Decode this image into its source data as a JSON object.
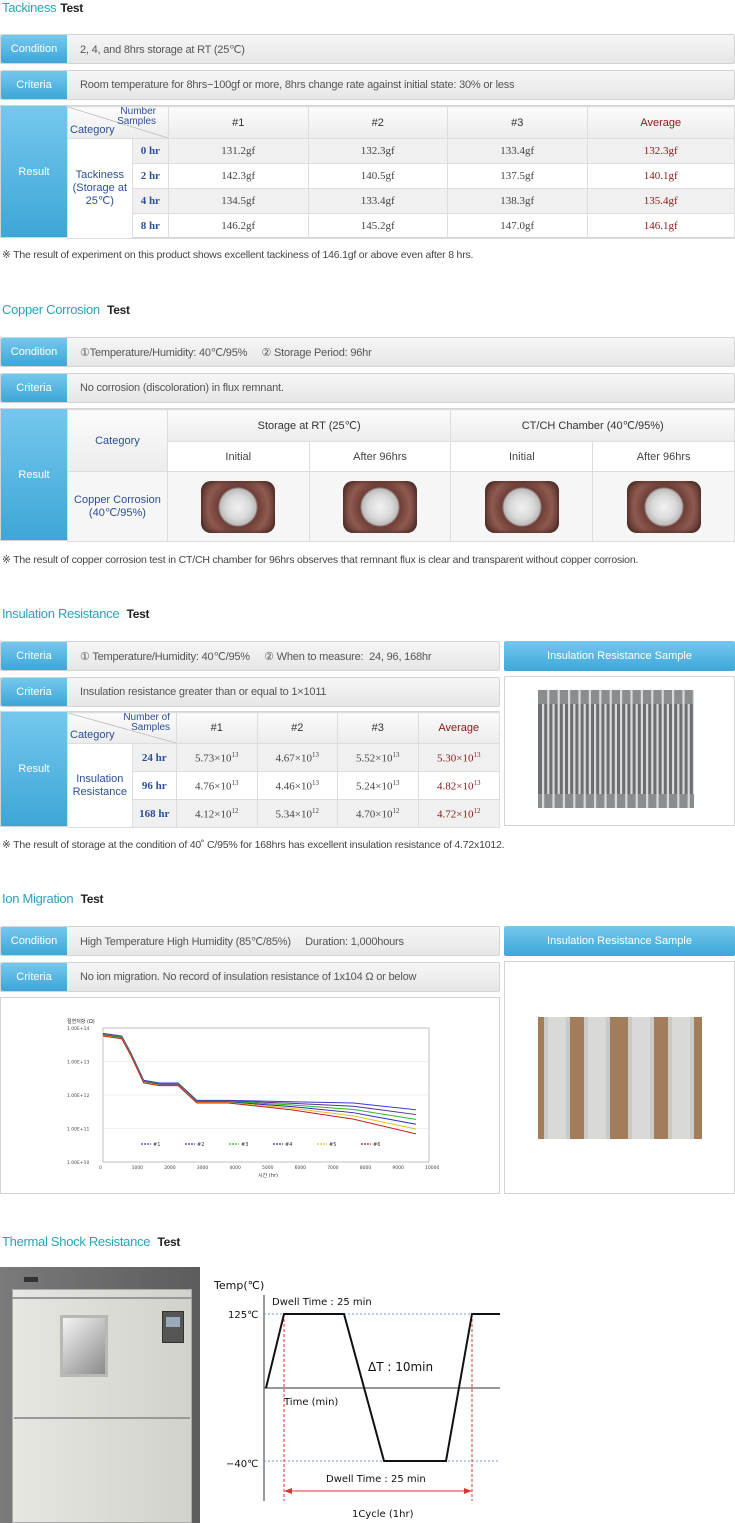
{
  "tackiness": {
    "title": "Tackiness",
    "test": "Test",
    "condition_label": "Condition",
    "condition": "2, 4, and 8hrs storage at RT (25℃)",
    "criteria_label": "Criteria",
    "criteria": "Room temperature for 8hrs−100gf or more, 8hrs change rate against initial state: 30% or less",
    "result_label": "Result",
    "number_samples": "Number Samples",
    "category": "Category",
    "headers": [
      "#1",
      "#2",
      "#3",
      "Average"
    ],
    "row_category": "Tackiness (Storage at 25℃)",
    "rows": [
      {
        "hr": "0 hr",
        "v1": "131.2gf",
        "v2": "132.3gf",
        "v3": "133.4gf",
        "avg": "132.3gf"
      },
      {
        "hr": "2 hr",
        "v1": "142.3gf",
        "v2": "140.5gf",
        "v3": "137.5gf",
        "avg": "140.1gf"
      },
      {
        "hr": "4 hr",
        "v1": "134.5gf",
        "v2": "133.4gf",
        "v3": "138.3gf",
        "avg": "135.4gf"
      },
      {
        "hr": "8 hr",
        "v1": "146.2gf",
        "v2": "145.2gf",
        "v3": "147.0gf",
        "avg": "146.1gf"
      }
    ],
    "note": "※ The result of experiment on this product shows excellent tackiness of 146.1gf or above even after 8 hrs."
  },
  "copper": {
    "title": "Copper Corrosion",
    "test": "Test",
    "condition_label": "Condition",
    "condition": "①Temperature/Humidity: 40℃/95%     ② Storage Period: 96hr",
    "criteria_label": "Criteria",
    "criteria": "No corrosion (discoloration) in flux remnant.",
    "result_label": "Result",
    "category": "Category",
    "group1": "Storage at RT (25℃)",
    "group2": "CT/CH Chamber (40℃/95%)",
    "sub": [
      "Initial",
      "After 96hrs",
      "Initial",
      "After 96hrs"
    ],
    "row_category": "Copper Corrosion (40℃/95%)",
    "note": "※ The result of copper corrosion test in CT/CH chamber for 96hrs observes that remnant flux is clear and transparent without copper corrosion."
  },
  "insulation": {
    "title": "Insulation Resistance",
    "test": "Test",
    "criteria_label": "Criteria",
    "criteria1": "① Temperature/Humidity: 40℃/95%     ② When to measure:  24, 96, 168hr",
    "criteria2": "Insulation resistance greater than or equal to 1×1011",
    "sample_label": "Insulation Resistance Sample",
    "result_label": "Result",
    "number_samples": "Number of Samples",
    "category": "Category",
    "headers": [
      "#1",
      "#2",
      "#3",
      "Average"
    ],
    "row_category": "Insulation Resistance",
    "rows": [
      {
        "hr": "24 hr",
        "v1": "5.73×10",
        "e1": "13",
        "v2": "4.67×10",
        "e2": "13",
        "v3": "5.52×10",
        "e3": "13",
        "avg": "5.30×10",
        "ea": "13"
      },
      {
        "hr": "96 hr",
        "v1": "4.76×10",
        "e1": "13",
        "v2": "4.46×10",
        "e2": "13",
        "v3": "5.24×10",
        "e3": "13",
        "avg": "4.82×10",
        "ea": "13"
      },
      {
        "hr": "168 hr",
        "v1": "4.12×10",
        "e1": "12",
        "v2": "5.34×10",
        "e2": "12",
        "v3": "4.70×10",
        "e3": "12",
        "avg": "4.72×10",
        "ea": "12"
      }
    ],
    "note": "※ The result of storage at the condition of 40˚ C/95% for 168hrs has excellent insulation resistance of 4.72x1012."
  },
  "ion": {
    "title": "Ion Migration",
    "test": "Test",
    "condition_label": "Condition",
    "condition": "High Temperature High Humidity (85℃/85%)     Duration: 1,000hours",
    "criteria_label": "Criteria",
    "criteria": "No ion migration. No record of insulation resistance of 1x104 Ω or below",
    "sample_label": "Insulation Resistance Sample",
    "chart_ylabel": "절연저항 (Ω)",
    "chart_xlabel": "시간 (hr)",
    "legend": [
      "#1",
      "#2",
      "#3",
      "#4",
      "#5",
      "#6"
    ],
    "legend_colors": [
      "#3b3bd6",
      "#5b2f8a",
      "#2bb52b",
      "#2a2ab0",
      "#e0c020",
      "#c02020"
    ],
    "ytick_labels": [
      "1.00E+14",
      "1.00E+13",
      "1.00E+12",
      "1.00E+11",
      "1.00E+10"
    ],
    "xtick_labels": [
      "0",
      "1000",
      "2000",
      "3000",
      "4000",
      "5000",
      "6000",
      "7000",
      "8000",
      "9000",
      "10000"
    ]
  },
  "thermal": {
    "title": "Thermal Shock Resistance",
    "test": "Test",
    "temp_axis": "Temp(℃)",
    "high": "125℃",
    "low": "−40℃",
    "dwell_top": "Dwell Time : 25 min",
    "dwell_bottom": "Dwell Time : 25 min",
    "delta": "ΔT : 10min",
    "time_axis": "Time (min)",
    "cycle": "1Cycle (1hr)"
  }
}
